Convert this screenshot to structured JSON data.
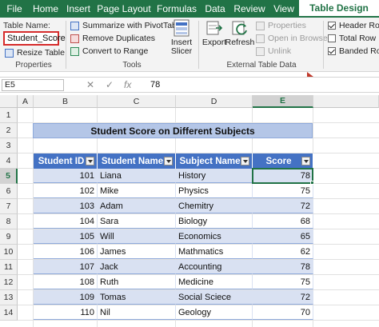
{
  "ribbon_tabs": [
    "File",
    "Home",
    "Insert",
    "Page Layout",
    "Formulas",
    "Data",
    "Review",
    "View",
    "Table Design"
  ],
  "properties": {
    "table_name_label": "Table Name:",
    "table_name_value": "Student_Score",
    "resize_label": "Resize Table",
    "group_label": "Properties"
  },
  "tools": {
    "summarize_label": "Summarize with PivotTable",
    "remove_duplicates_label": "Remove Duplicates",
    "convert_label": "Convert to Range",
    "insert_slicer_line1": "Insert",
    "insert_slicer_line2": "Slicer",
    "group_label": "Tools"
  },
  "external": {
    "export_label": "Export",
    "refresh_label": "Refresh",
    "properties_label": "Properties",
    "open_browser_label": "Open in Browser",
    "unlink_label": "Unlink",
    "group_label": "External Table Data"
  },
  "style_options": {
    "header_row_label": "Header Row",
    "total_row_label": "Total Row",
    "banded_rows_label": "Banded Row"
  },
  "formula_bar": {
    "name_box": "E5",
    "cancel_icon": "✕",
    "enter_icon": "✓",
    "fx_icon": "fx",
    "value": "78"
  },
  "columns": [
    "A",
    "B",
    "C",
    "D",
    "E"
  ],
  "rows": [
    "1",
    "2",
    "3",
    "4",
    "5",
    "6",
    "7",
    "8",
    "9",
    "10",
    "11",
    "12",
    "13",
    "14"
  ],
  "sheet": {
    "title": "Student Score on Different Subjects",
    "headers": [
      "Student ID",
      "Student Name",
      "Subject Name",
      "Score"
    ],
    "records": [
      {
        "id": "101",
        "name": "Liana",
        "subject": "History",
        "score": "78"
      },
      {
        "id": "102",
        "name": "Mike",
        "subject": "Physics",
        "score": "75"
      },
      {
        "id": "103",
        "name": "Adam",
        "subject": "Chemitry",
        "score": "72"
      },
      {
        "id": "104",
        "name": "Sara",
        "subject": "Biology",
        "score": "68"
      },
      {
        "id": "105",
        "name": "Will",
        "subject": "Economics",
        "score": "65"
      },
      {
        "id": "106",
        "name": "James",
        "subject": "Mathmatics",
        "score": "62"
      },
      {
        "id": "107",
        "name": "Jack",
        "subject": "Accounting",
        "score": "78"
      },
      {
        "id": "108",
        "name": "Ruth",
        "subject": "Medicine",
        "score": "75"
      },
      {
        "id": "109",
        "name": "Tomas",
        "subject": "Social Sciece",
        "score": "72"
      },
      {
        "id": "110",
        "name": "Nil",
        "subject": "Geology",
        "score": "70"
      }
    ]
  },
  "colors": {
    "excel_green": "#217346",
    "table_header": "#4472c4",
    "title_fill": "#b4c6e7",
    "highlight_border": "#d62b2b"
  }
}
